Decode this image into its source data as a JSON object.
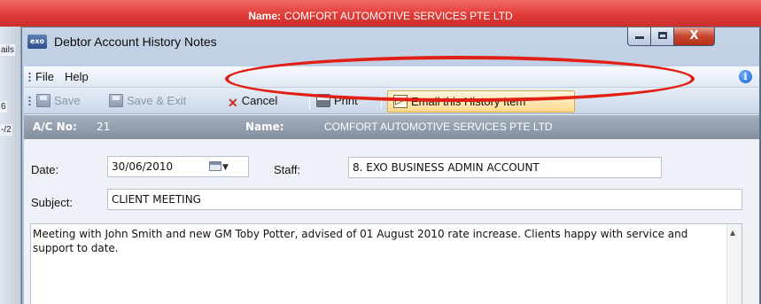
{
  "background_window": {
    "title_label": "Name:",
    "title_value": "COMFORT AUTOMOTIVE SERVICES PTE LTD",
    "left_fragments": [
      "ails",
      "6",
      "-/2"
    ]
  },
  "window": {
    "app_icon_text": "exo",
    "title": "Debtor Account History Notes",
    "caption_close": "X"
  },
  "menu": {
    "file": "File",
    "help": "Help",
    "info_icon": "i"
  },
  "toolbar": {
    "save": "Save",
    "save_exit": "Save & Exit",
    "cancel": "Cancel",
    "print": "Print",
    "email": "Email this History Item"
  },
  "account_bar": {
    "ac_label": "A/C No:",
    "ac_number": "21",
    "name_label": "Name:",
    "name_value": "COMFORT AUTOMOTIVE SERVICES PTE LTD"
  },
  "form": {
    "date_label": "Date:",
    "date_value": "30/06/2010",
    "staff_label": "Staff:",
    "staff_value": "8. EXO BUSINESS ADMIN ACCOUNT",
    "subject_label": "Subject:",
    "subject_value": "CLIENT MEETING",
    "notes": "Meeting with John Smith and new GM Toby Potter, advised of 01 August 2010 rate increase. Clients happy with service and support to date."
  },
  "colors": {
    "highlight": "#e21f14",
    "email_button_bg": "#ffd98c",
    "account_bar": "#8f9bab"
  }
}
